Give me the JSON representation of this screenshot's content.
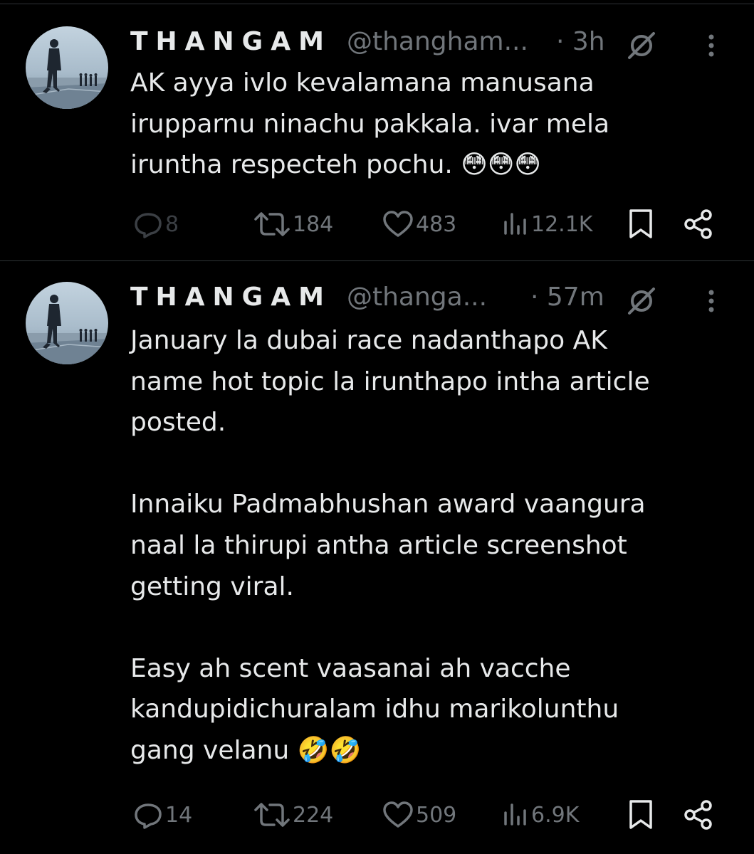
{
  "tweets": [
    {
      "display_name": "THANGAM",
      "handle": "@thangham...",
      "time": "· 3h",
      "text": "AK ayya ivlo kevalamana manusana\nirupparnu ninachu pakkala. ivar mela\niruntha respecteh pochu. 😳😳😳",
      "replies": "8",
      "reposts": "184",
      "likes": "483",
      "views": "12.1K"
    },
    {
      "display_name": "THANGAM",
      "handle": "@thanga...",
      "time": "· 57m",
      "text": "January la dubai race nadanthapo AK\nname hot topic la irunthapo intha article\nposted.\n\nInnaiku Padmabhushan award vaangura\nnaal la thirupi antha article screenshot\ngetting viral.\n\nEasy ah scent vaasanai ah vacche\nkandupidichuralam idhu marikolunthu\ngang velanu 🤣🤣",
      "replies": "14",
      "reposts": "224",
      "likes": "509",
      "views": "6.9K"
    }
  ],
  "colors": {
    "background": "#000000",
    "text": "#e7e9ea",
    "secondary": "#71767b",
    "divider": "#2f3336"
  },
  "icons": {
    "reply": "reply-icon",
    "repost": "repost-icon",
    "like": "heart-icon",
    "views": "views-icon",
    "bookmark": "bookmark-icon",
    "share": "share-icon",
    "grok": "grok-icon",
    "more": "more-icon"
  }
}
